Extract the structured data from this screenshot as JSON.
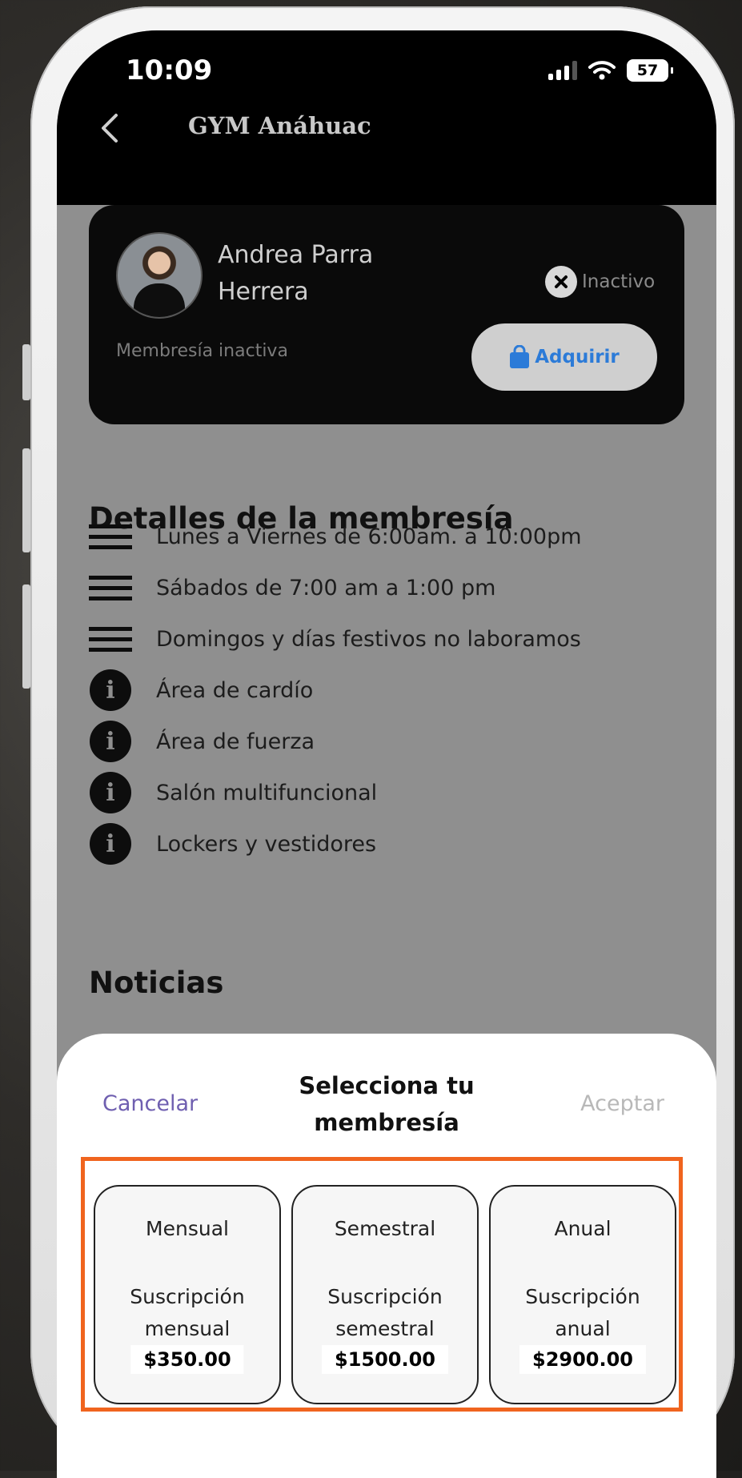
{
  "status_bar": {
    "time": "10:09",
    "battery": "57"
  },
  "header": {
    "title": "GYM Anáhuac"
  },
  "profile": {
    "name_line1": "Andrea Parra",
    "name_line2": "Herrera",
    "status": "Inactivo",
    "membership_status": "Membresía inactiva",
    "acquire_label": "Adquirir"
  },
  "details": {
    "heading": "Detalles de la membresía",
    "items": [
      {
        "icon": "menu-icon",
        "text": "Lunes a Viernes de 6:00am. a 10:00pm"
      },
      {
        "icon": "menu-icon",
        "text": "Sábados de 7:00 am a 1:00 pm"
      },
      {
        "icon": "menu-icon",
        "text": "Domingos y días festivos no laboramos"
      },
      {
        "icon": "info-icon",
        "text": "Área de cardío"
      },
      {
        "icon": "info-icon",
        "text": "Área de fuerza"
      },
      {
        "icon": "info-icon",
        "text": "Salón multifuncional"
      },
      {
        "icon": "info-icon",
        "text": "Lockers y vestidores"
      }
    ]
  },
  "news": {
    "heading": "Noticias"
  },
  "sheet": {
    "cancel_label": "Cancelar",
    "title_line1": "Selecciona tu",
    "title_line2": "membresía",
    "accept_label": "Aceptar",
    "options": [
      {
        "name": "Mensual",
        "desc_line1": "Suscripción",
        "desc_line2": "mensual",
        "price": "$350.00"
      },
      {
        "name": "Semestral",
        "desc_line1": "Suscripción",
        "desc_line2": "semestral",
        "price": "$1500.00"
      },
      {
        "name": "Anual",
        "desc_line1": "Suscripción",
        "desc_line2": "anual",
        "price": "$2900.00"
      }
    ]
  },
  "colors": {
    "highlight": "#f0641e",
    "accent": "#2c7bd8",
    "cancel": "#6f5fb0"
  }
}
